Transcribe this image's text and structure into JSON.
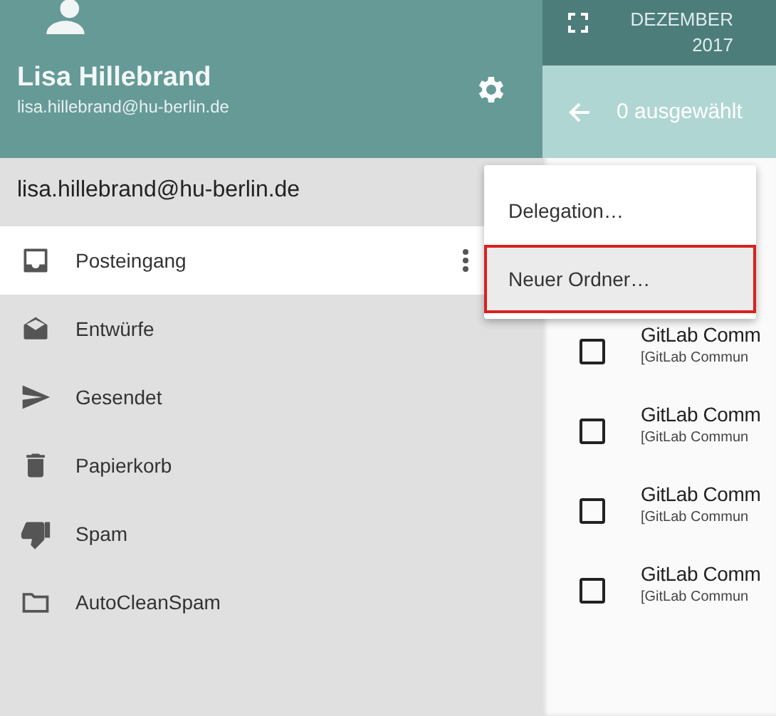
{
  "drawer": {
    "user": {
      "name": "Lisa Hillebrand",
      "email": "lisa.hillebrand@hu-berlin.de"
    },
    "account": "lisa.hillebrand@hu-berlin.de",
    "folders": [
      {
        "label": "Posteingang",
        "kind": "inbox",
        "selected": true
      },
      {
        "label": "Entwürfe",
        "kind": "drafts",
        "selected": false
      },
      {
        "label": "Gesendet",
        "kind": "sent",
        "selected": false
      },
      {
        "label": "Papierkorb",
        "kind": "trash",
        "selected": false
      },
      {
        "label": "Spam",
        "kind": "spam",
        "selected": false
      },
      {
        "label": "AutoCleanSpam",
        "kind": "folder",
        "selected": false
      }
    ]
  },
  "context_menu": {
    "items": [
      {
        "label": "Delegation…",
        "highlighted": false
      },
      {
        "label": "Neuer Ordner…",
        "highlighted": true
      }
    ]
  },
  "date_header": {
    "month": "DEZEMBER",
    "year": "2017"
  },
  "selection_bar": {
    "text": "0 ausgewählt"
  },
  "messages": [
    {
      "sender": "GitLab Comm",
      "subject": "[GitLab Commun",
      "checked": false
    },
    {
      "sender": "GitLab Comm",
      "subject": "[GitLab Commun",
      "checked": false
    },
    {
      "sender": "GitLab Comm",
      "subject": "[GitLab Commun",
      "checked": false
    },
    {
      "sender": "GitLab Comm",
      "subject": "[GitLab Commun",
      "checked": false
    }
  ]
}
